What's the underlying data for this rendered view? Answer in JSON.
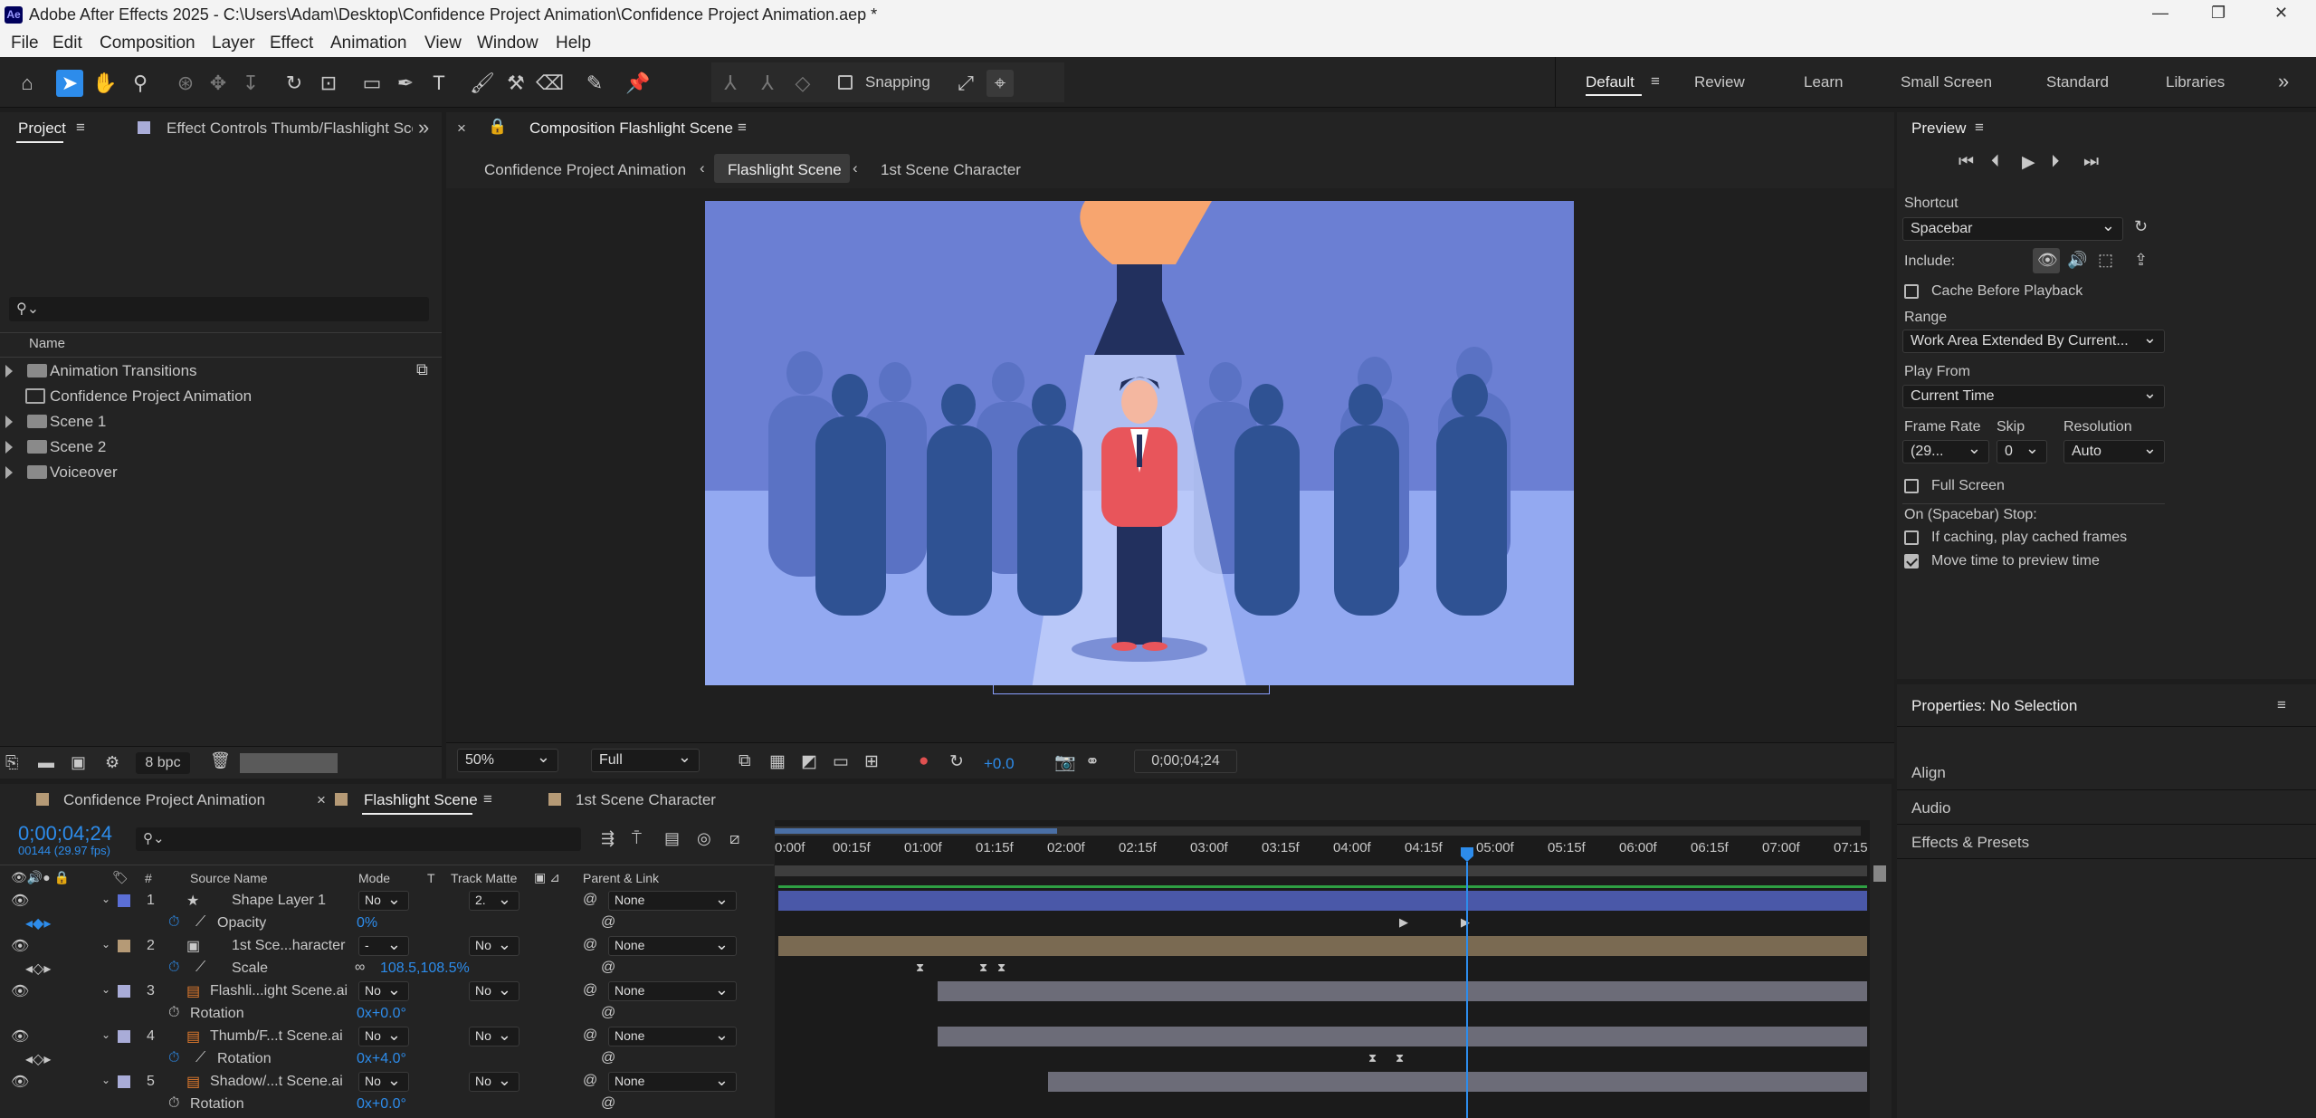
{
  "window": {
    "title": "Adobe After Effects 2025 - C:\\Users\\Adam\\Desktop\\Confidence Project Animation\\Confidence Project Animation.aep *",
    "app_icon": "Ae"
  },
  "menu": [
    "File",
    "Edit",
    "Composition",
    "Layer",
    "Effect",
    "Animation",
    "View",
    "Window",
    "Help"
  ],
  "toolbar": {
    "snapping": "Snapping"
  },
  "workspaces": [
    "Default",
    "Review",
    "Learn",
    "Small Screen",
    "Standard",
    "Libraries"
  ],
  "project": {
    "tab": "Project",
    "effect_controls_tab": "Effect Controls Thumb/Flashlight Sce",
    "search_placeholder": "",
    "column_name": "Name",
    "items": [
      {
        "name": "Animation Transitions",
        "type": "folder"
      },
      {
        "name": "Confidence Project Animation",
        "type": "comp"
      },
      {
        "name": "Scene 1",
        "type": "folder"
      },
      {
        "name": "Scene 2",
        "type": "folder"
      },
      {
        "name": "Voiceover",
        "type": "folder"
      }
    ],
    "bpc": "8 bpc"
  },
  "composition": {
    "tab": "Composition Flashlight Scene",
    "breadcrumbs": [
      "Confidence Project Animation",
      "Flashlight Scene",
      "1st Scene Character"
    ],
    "zoom": "50%",
    "resolution": "Full",
    "exposure": "+0.0",
    "timecode": "0;00;04;24"
  },
  "preview": {
    "title": "Preview",
    "shortcut_label": "Shortcut",
    "shortcut": "Spacebar",
    "include_label": "Include:",
    "cache_before_playback": "Cache Before Playback",
    "range_label": "Range",
    "range": "Work Area Extended By Current...",
    "play_from_label": "Play From",
    "play_from": "Current Time",
    "frame_rate_label": "Frame Rate",
    "frame_rate": "(29...",
    "skip_label": "Skip",
    "skip": "0",
    "resolution_label": "Resolution",
    "resolution": "Auto",
    "full_screen": "Full Screen",
    "on_stop_label": "On (Spacebar) Stop:",
    "if_caching": "If caching, play cached frames",
    "move_time": "Move time to preview time"
  },
  "properties": {
    "title": "Properties: No Selection",
    "sections": [
      "Align",
      "Audio",
      "Effects & Presets"
    ]
  },
  "timeline": {
    "tabs": [
      "Confidence Project Animation",
      "Flashlight Scene",
      "1st Scene Character"
    ],
    "timecode": "0;00;04;24",
    "frames": "00144 (29.97 fps)",
    "headers": {
      "num": "#",
      "source": "Source Name",
      "mode": "Mode",
      "t": "T",
      "track_matte": "Track Matte",
      "parent": "Parent & Link"
    },
    "ruler": [
      "0:00f",
      "00:15f",
      "01:00f",
      "01:15f",
      "02:00f",
      "02:15f",
      "03:00f",
      "03:15f",
      "04:00f",
      "04:15f",
      "05:00f",
      "05:15f",
      "06:00f",
      "06:15f",
      "07:00f",
      "07:15"
    ],
    "layers": [
      {
        "num": "1",
        "name": "Shape Layer 1",
        "mode": "No",
        "matte": "2.",
        "parent": "None",
        "color": "#5b6fd6"
      },
      {
        "prop": "Opacity",
        "value": "0%"
      },
      {
        "num": "2",
        "name": "1st Sce...haracter",
        "mode": "-",
        "matte": "No",
        "parent": "None",
        "color": "#b59a76"
      },
      {
        "prop": "Scale",
        "value": "108.5,108.5%"
      },
      {
        "num": "3",
        "name": "Flashli...ight Scene.ai",
        "mode": "No",
        "matte": "No",
        "parent": "None",
        "color": "#a9acd8"
      },
      {
        "prop": "Rotation",
        "value": "0x+0.0°"
      },
      {
        "num": "4",
        "name": "Thumb/F...t Scene.ai",
        "mode": "No",
        "matte": "No",
        "parent": "None",
        "color": "#a9acd8"
      },
      {
        "prop": "Rotation",
        "value": "0x+4.0°"
      },
      {
        "num": "5",
        "name": "Shadow/...t Scene.ai",
        "mode": "No",
        "matte": "No",
        "parent": "None",
        "color": "#a9acd8"
      },
      {
        "prop": "Rotation",
        "value": "0x+0.0°"
      }
    ]
  },
  "colors": {
    "accent": "#2d8ceb",
    "playhead": "#2d8ceb",
    "canvas_bg": "#6b7fd3"
  }
}
